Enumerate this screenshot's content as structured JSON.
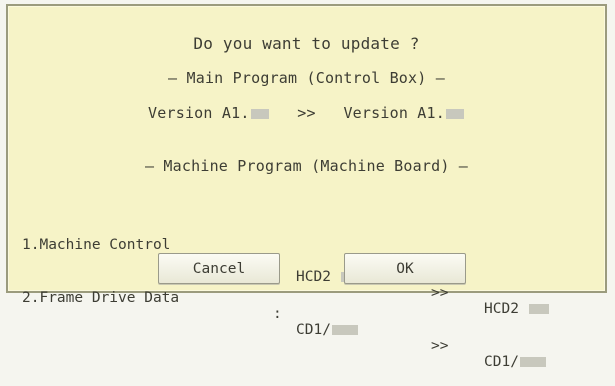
{
  "dialog": {
    "prompt": "Do you want to update ?",
    "main_program": {
      "heading": "— Main Program (Control Box) —",
      "current_prefix": "Version A1.",
      "arrow": ">>",
      "new_prefix": "Version A1."
    },
    "machine_program": {
      "heading": "— Machine Program (Machine Board) —",
      "rows": [
        {
          "name": "1.Machine Control",
          "separator": ":",
          "current_prefix": "HCD2",
          "arrow": ">>",
          "new_prefix": "HCD2"
        },
        {
          "name": "2.Frame Drive Data",
          "separator": ":",
          "current_prefix": "CD1/",
          "arrow": ">>",
          "new_prefix": "CD1/"
        }
      ]
    },
    "buttons": {
      "cancel": "Cancel",
      "ok": "OK"
    }
  }
}
